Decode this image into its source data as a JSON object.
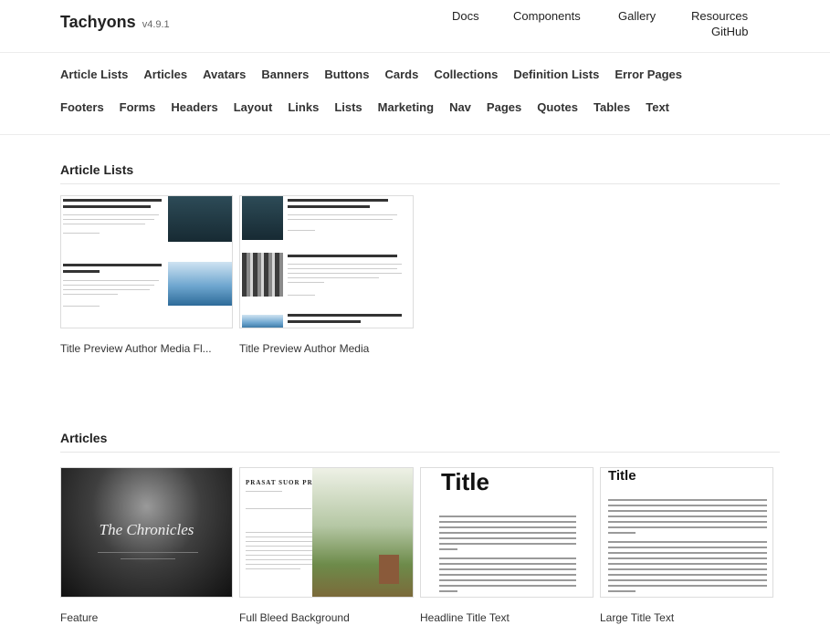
{
  "header": {
    "brand": "Tachyons",
    "version": "v4.9.1",
    "nav": [
      "Docs",
      "Components",
      "Gallery",
      "Resources",
      "GitHub"
    ]
  },
  "categories": {
    "row1": [
      "Article Lists",
      "Articles",
      "Avatars",
      "Banners",
      "Buttons",
      "Cards",
      "Collections",
      "Definition Lists",
      "Error Pages"
    ],
    "row2": [
      "Footers",
      "Forms",
      "Headers",
      "Layout",
      "Links",
      "Lists",
      "Marketing",
      "Nav",
      "Pages",
      "Quotes",
      "Tables",
      "Text"
    ]
  },
  "sections": {
    "article_lists": {
      "title": "Article Lists",
      "items": [
        "Title Preview Author Media Fl...",
        "Title Preview Author Media"
      ]
    },
    "articles": {
      "title": "Articles",
      "items": [
        "Feature",
        "Full Bleed Background",
        "Headline Title Text",
        "Large Title Text"
      ],
      "preview_texts": {
        "feature_title": "The Chronicles",
        "full_bleed_title": "PRASAT SUOR PRAT",
        "headline_title": "Title",
        "large_title": "Title"
      }
    }
  }
}
